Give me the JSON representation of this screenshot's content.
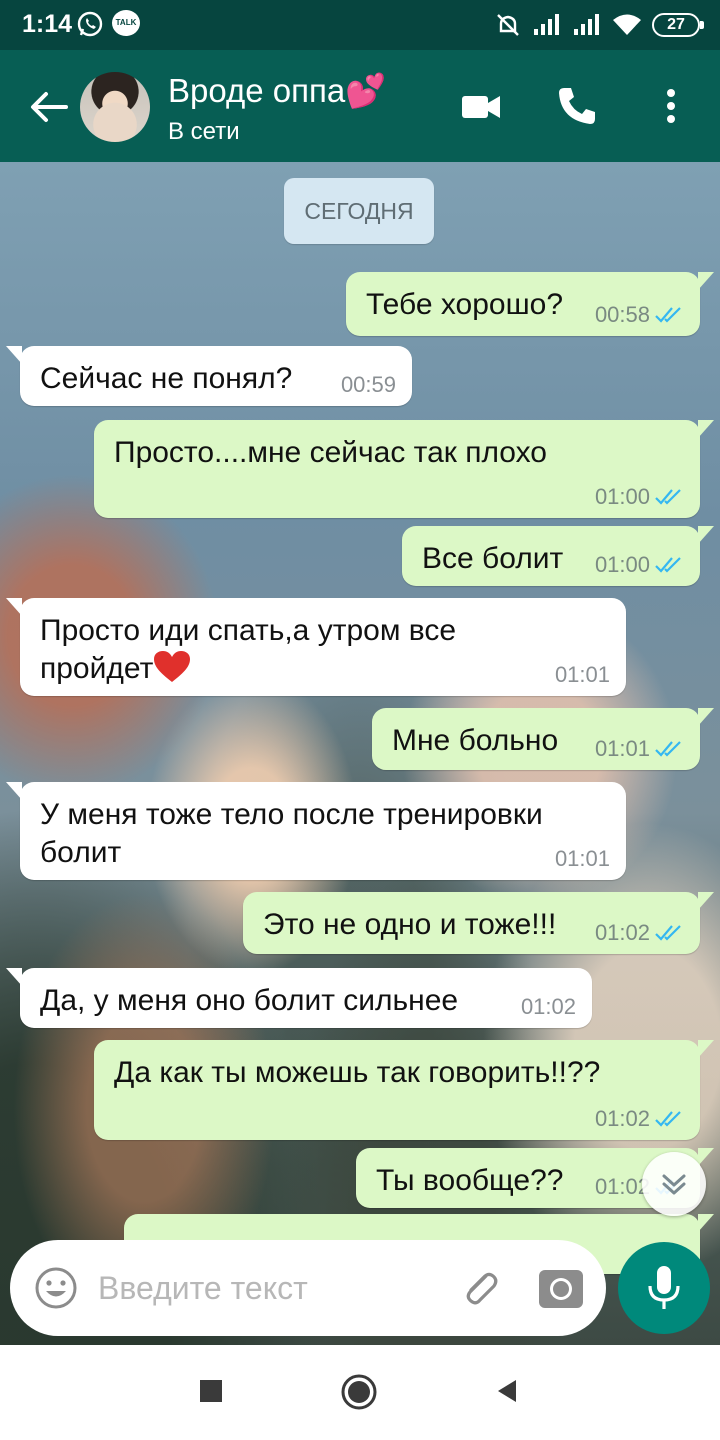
{
  "status_bar": {
    "time": "1:14",
    "talk_label": "TALK",
    "battery": "27"
  },
  "header": {
    "contact_name": "Вроде оппа💕",
    "status": "В сети"
  },
  "chat": {
    "date_label": "СЕГОДНЯ",
    "messages": [
      {
        "dir": "out",
        "text": "Тебе хорошо?",
        "time": "00:58",
        "read": true
      },
      {
        "dir": "in",
        "text": "Сейчас не понял?",
        "time": "00:59"
      },
      {
        "dir": "out",
        "text": "Просто....мне сейчас так плохо",
        "time": "01:00",
        "read": true
      },
      {
        "dir": "out",
        "text": "Все болит",
        "time": "01:00",
        "read": true
      },
      {
        "dir": "in",
        "text_line1": "Просто иди спать,а утром все",
        "text_line2": "пройдет",
        "emoji": "red-heart",
        "time": "01:01"
      },
      {
        "dir": "out",
        "text": "Мне больно",
        "time": "01:01",
        "read": true
      },
      {
        "dir": "in",
        "text_line1": "У меня тоже тело после тренировки",
        "text_line2": "болит",
        "time": "01:01"
      },
      {
        "dir": "out",
        "text": "Это не одно и тоже!!!",
        "time": "01:02",
        "read": true
      },
      {
        "dir": "in",
        "text": "Да, у меня оно болит сильнее",
        "time": "01:02"
      },
      {
        "dir": "out",
        "text": "Да как ты можешь так говорить!!??",
        "time": "01:02",
        "read": true
      },
      {
        "dir": "out",
        "text": "Ты вообще??",
        "time": "01:02",
        "read": true
      }
    ]
  },
  "composer": {
    "placeholder": "Введите текст"
  },
  "colors": {
    "header": "#075e54",
    "status_bar": "#06453f",
    "outgoing_bubble": "#dcf8c6",
    "incoming_bubble": "#ffffff",
    "read_tick": "#34b7f1",
    "mic_button": "#00897b"
  },
  "icons": [
    "whatsapp-icon",
    "talk-icon",
    "mute-icon",
    "signal-icon",
    "wifi-icon",
    "battery-icon",
    "back-arrow-icon",
    "video-call-icon",
    "phone-icon",
    "more-options-icon",
    "double-check-icon",
    "red-heart-emoji",
    "chevron-down-icon",
    "emoji-icon",
    "attach-icon",
    "camera-icon",
    "mic-icon",
    "nav-square-icon",
    "nav-home-icon",
    "nav-back-icon"
  ]
}
